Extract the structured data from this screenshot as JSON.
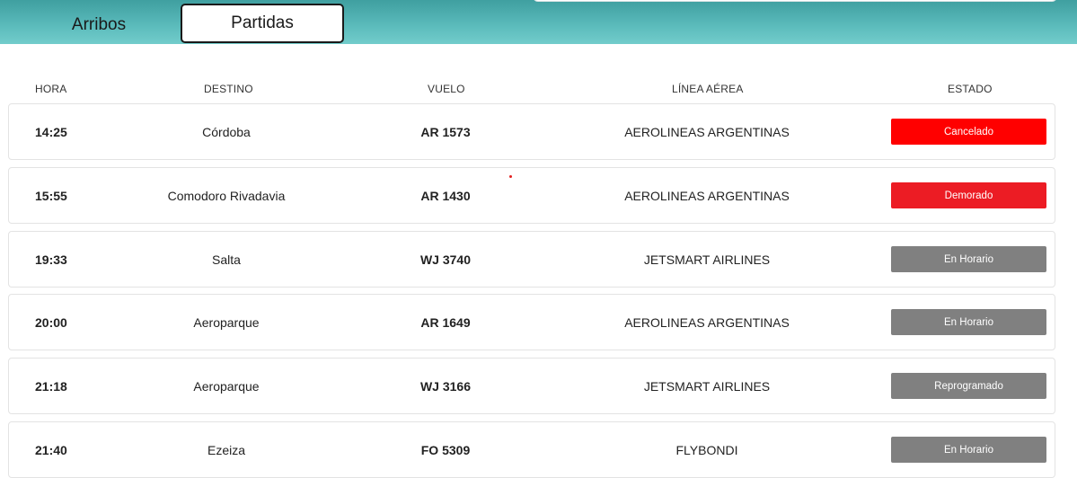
{
  "tabs": {
    "arribos_label": "Arribos",
    "partidas_label": "Partidas",
    "active": "Partidas"
  },
  "columns": {
    "hora": "HORA",
    "destino": "DESTINO",
    "vuelo": "VUELO",
    "linea": "LÍNEA AÉREA",
    "estado": "ESTADO"
  },
  "colors": {
    "header_teal": "#5cbcbc",
    "cancelado": "#ff0000",
    "demorado": "#ec1c24",
    "en_horario": "#808080",
    "reprogramado": "#808080"
  },
  "flights": [
    {
      "hora": "14:25",
      "destino": "Córdoba",
      "vuelo": "AR 1573",
      "linea": "AEROLINEAS ARGENTINAS",
      "estado": "Cancelado",
      "estado_color": "#ff0000"
    },
    {
      "hora": "15:55",
      "destino": "Comodoro Rivadavia",
      "vuelo": "AR 1430",
      "linea": "AEROLINEAS ARGENTINAS",
      "estado": "Demorado",
      "estado_color": "#ec1c24"
    },
    {
      "hora": "19:33",
      "destino": "Salta",
      "vuelo": "WJ 3740",
      "linea": "JETSMART AIRLINES",
      "estado": "En Horario",
      "estado_color": "#808080"
    },
    {
      "hora": "20:00",
      "destino": "Aeroparque",
      "vuelo": "AR 1649",
      "linea": "AEROLINEAS ARGENTINAS",
      "estado": "En Horario",
      "estado_color": "#808080"
    },
    {
      "hora": "21:18",
      "destino": "Aeroparque",
      "vuelo": "WJ 3166",
      "linea": "JETSMART AIRLINES",
      "estado": "Reprogramado",
      "estado_color": "#808080"
    },
    {
      "hora": "21:40",
      "destino": "Ezeiza",
      "vuelo": "FO 5309",
      "linea": "FLYBONDI",
      "estado": "En Horario",
      "estado_color": "#808080"
    }
  ]
}
